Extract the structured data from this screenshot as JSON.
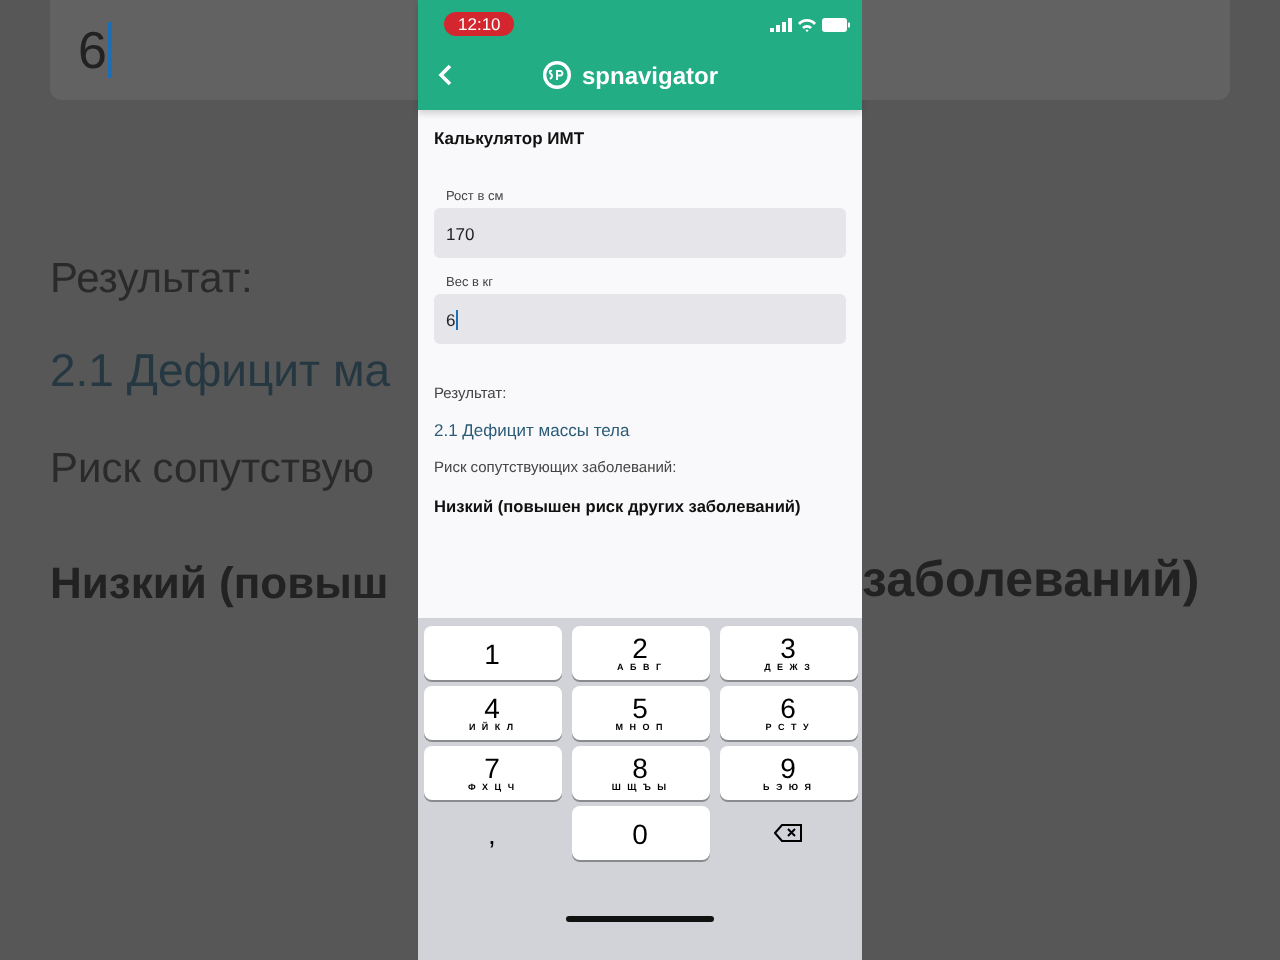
{
  "backdrop": {
    "field": {
      "value": "6",
      "focused": true
    },
    "left_texts": [
      {
        "kind": "label",
        "text": "Результат:"
      },
      {
        "kind": "result",
        "text": "2.1 Дефицит ма"
      },
      {
        "kind": "label",
        "text": "Риск сопутствую"
      },
      {
        "kind": "bold",
        "text": "Низкий (повыш"
      }
    ],
    "right_texts": [
      {
        "kind": "bold",
        "text": "заболеваний)"
      }
    ]
  },
  "status_bar": {
    "time": "12:10"
  },
  "app_bar": {
    "title": "spnavigator"
  },
  "page_title": "Калькулятор ИМТ",
  "fields": [
    {
      "label": "Рост в см",
      "value": "170",
      "focused": false
    },
    {
      "label": "Вес в кг",
      "value": "6",
      "focused": true
    }
  ],
  "results": [
    {
      "kind": "label",
      "text": "Результат:"
    },
    {
      "kind": "result",
      "text": "2.1 Дефицит массы тела"
    },
    {
      "kind": "label",
      "text": "Риск сопутствующих заболеваний:"
    },
    {
      "kind": "bold",
      "text": "Низкий (повышен риск других заболеваний)"
    }
  ],
  "keyboard": [
    {
      "kind": "digit",
      "digit": "1"
    },
    {
      "kind": "digit",
      "digit": "2",
      "letters": "А Б В Г"
    },
    {
      "kind": "digit",
      "digit": "3",
      "letters": "Д Е Ж З"
    },
    {
      "kind": "digit",
      "digit": "4",
      "letters": "И Й К Л"
    },
    {
      "kind": "digit",
      "digit": "5",
      "letters": "М Н О П"
    },
    {
      "kind": "digit",
      "digit": "6",
      "letters": "Р С Т У"
    },
    {
      "kind": "digit",
      "digit": "7",
      "letters": "Ф Х Ц Ч"
    },
    {
      "kind": "digit",
      "digit": "8",
      "letters": "Ш Щ Ъ Ы"
    },
    {
      "kind": "digit",
      "digit": "9",
      "letters": "Ь Э Ю Я"
    },
    {
      "kind": "symbol",
      "digit": ","
    },
    {
      "kind": "digit",
      "digit": "0"
    },
    {
      "kind": "delete"
    }
  ]
}
